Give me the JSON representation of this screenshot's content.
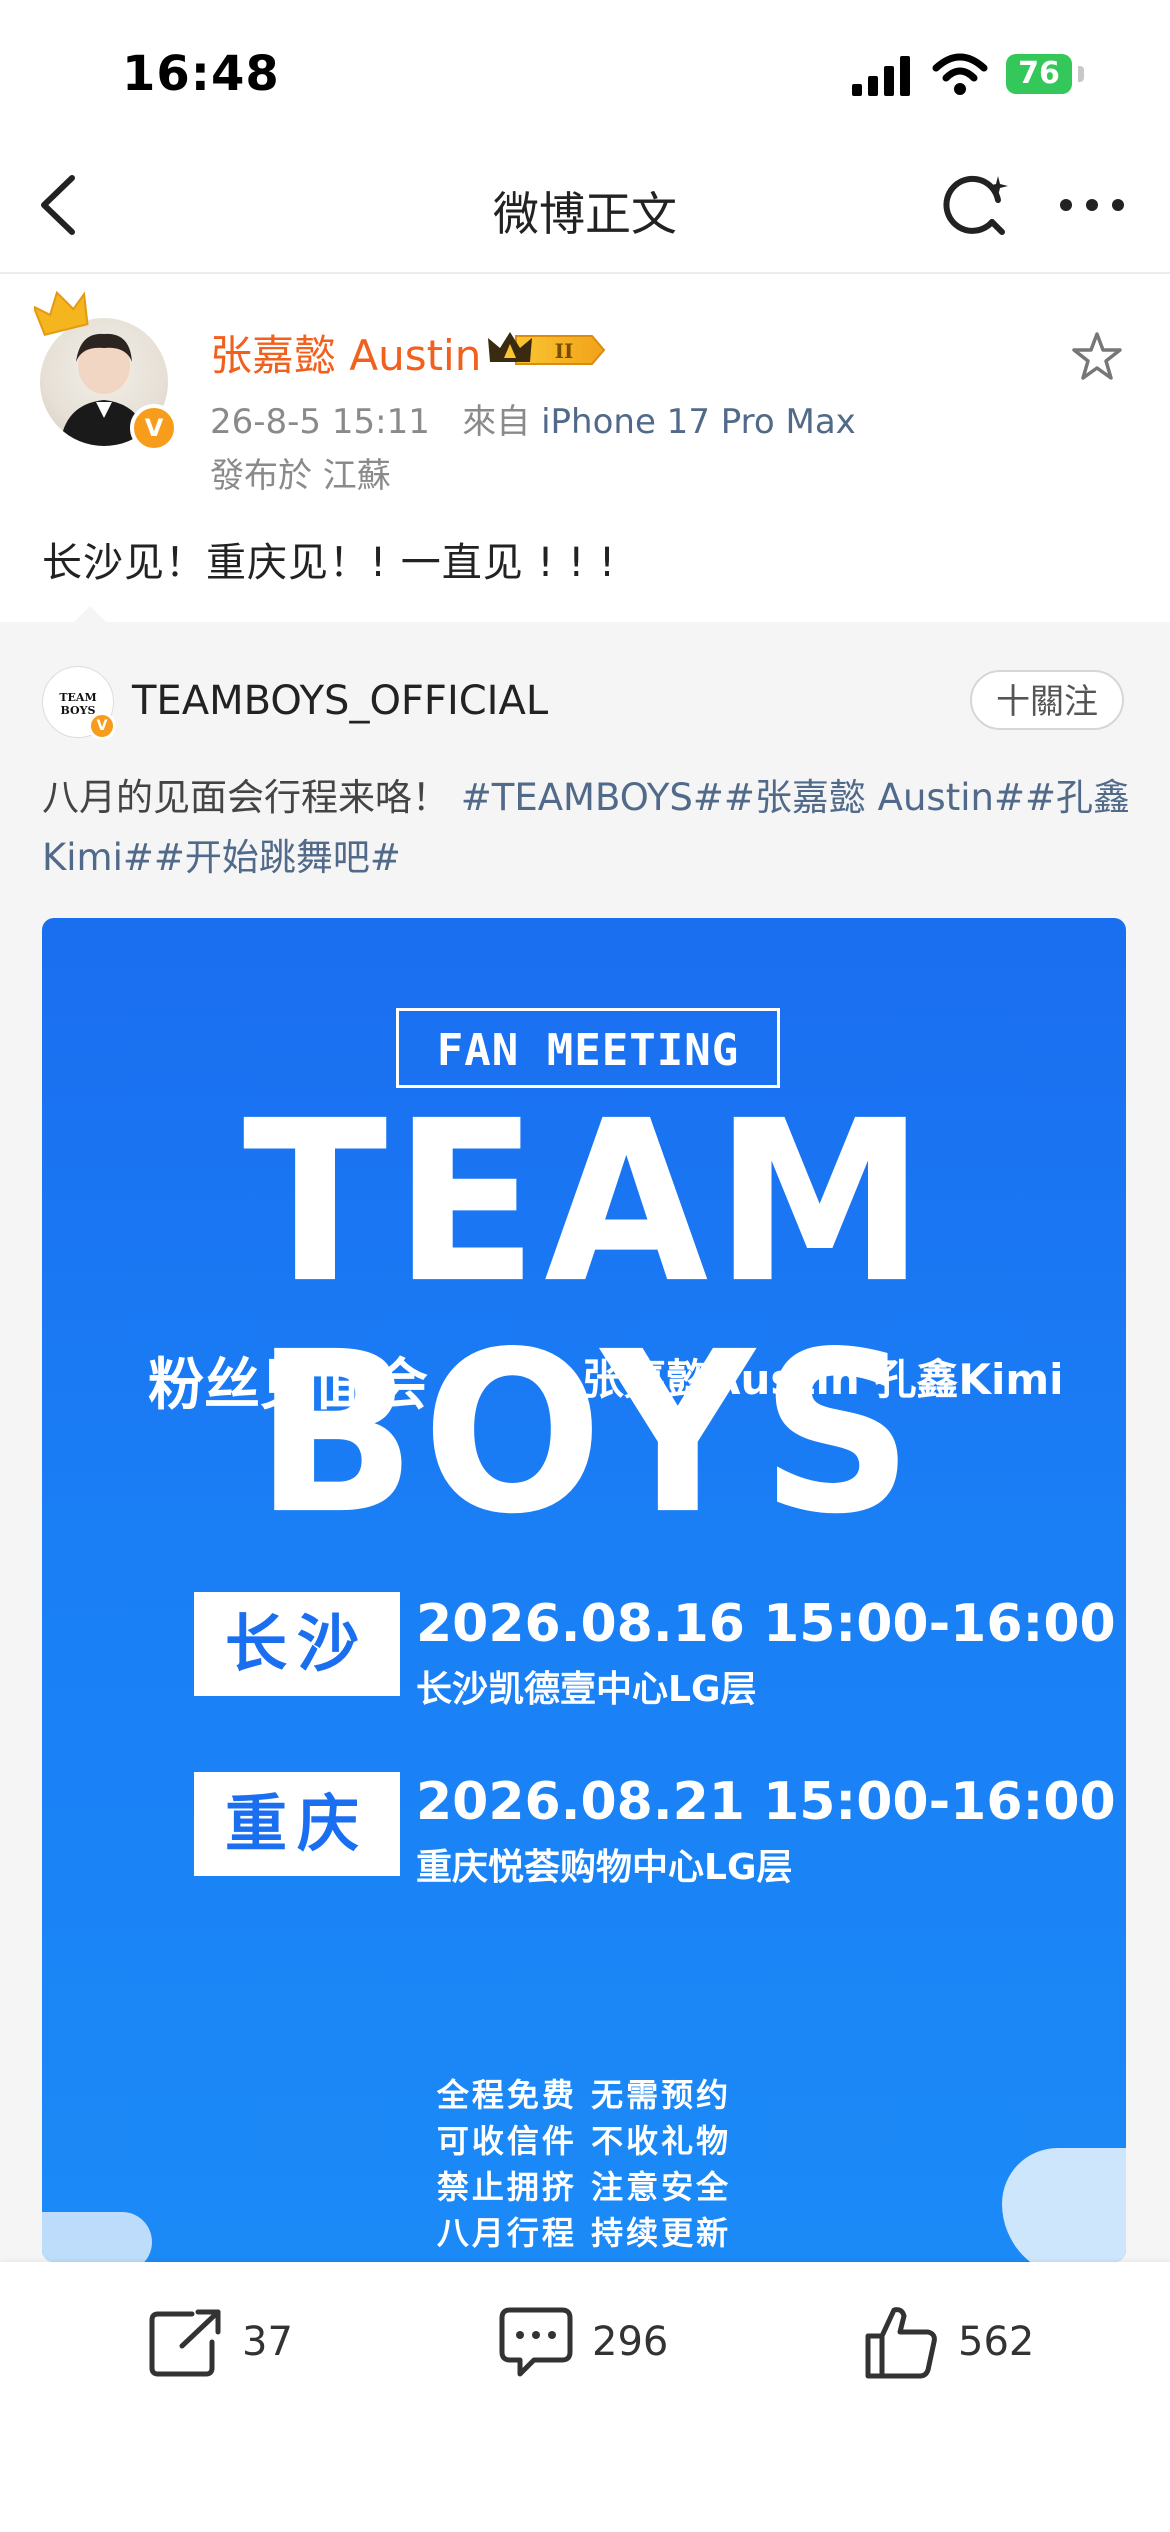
{
  "status_bar": {
    "time": "16:48",
    "battery": "76"
  },
  "nav": {
    "title": "微博正文"
  },
  "post": {
    "username": "张嘉懿 Austin",
    "vip_level": "II",
    "time": "26-8-5 15:11",
    "source_prefix": "來自",
    "source": "iPhone 17 Pro Max",
    "location": "發布於 江蘇",
    "text": "长沙见！重庆见！! 一直见 ! ! !"
  },
  "repost": {
    "avatar_text": "TEAM BOYS",
    "name": "TEAMBOYS_OFFICIAL",
    "follow_label": "十關注",
    "text_plain": "八月的见面会行程来咯！ ",
    "text_tags": "#TEAMBOYS##张嘉懿 Austin##孔鑫Kimi##开始跳舞吧#"
  },
  "poster": {
    "label": "FAN MEETING",
    "title": "TEAM BOYS",
    "subtitle": "粉丝见面会",
    "members": "张嘉懿Austin  孔鑫Kimi",
    "events": [
      {
        "city": "长沙",
        "date": "2026.08.16  15:00-16:00",
        "venue": "长沙凯德壹中心LG层"
      },
      {
        "city": "重庆",
        "date": "2026.08.21  15:00-16:00",
        "venue": "重庆悦荟购物中心LG层"
      }
    ],
    "notes": [
      "全程免费 无需预约",
      "可收信件 不收礼物",
      "禁止拥挤 注意安全",
      "八月行程 持续更新"
    ],
    "colors": {
      "background": "#1a7ef5",
      "text": "#ffffff"
    }
  },
  "actions": {
    "repost_count": "37",
    "comment_count": "296",
    "like_count": "562"
  },
  "colors": {
    "username": "#f2601e",
    "link": "#516a8a",
    "verify": "#f79c1b"
  },
  "icons": [
    "back-icon",
    "refresh-icon",
    "more-icon",
    "star-icon",
    "share-icon",
    "comment-icon",
    "like-icon",
    "wifi-icon",
    "signal-icon",
    "battery-icon",
    "crown-icon",
    "verified-icon"
  ]
}
